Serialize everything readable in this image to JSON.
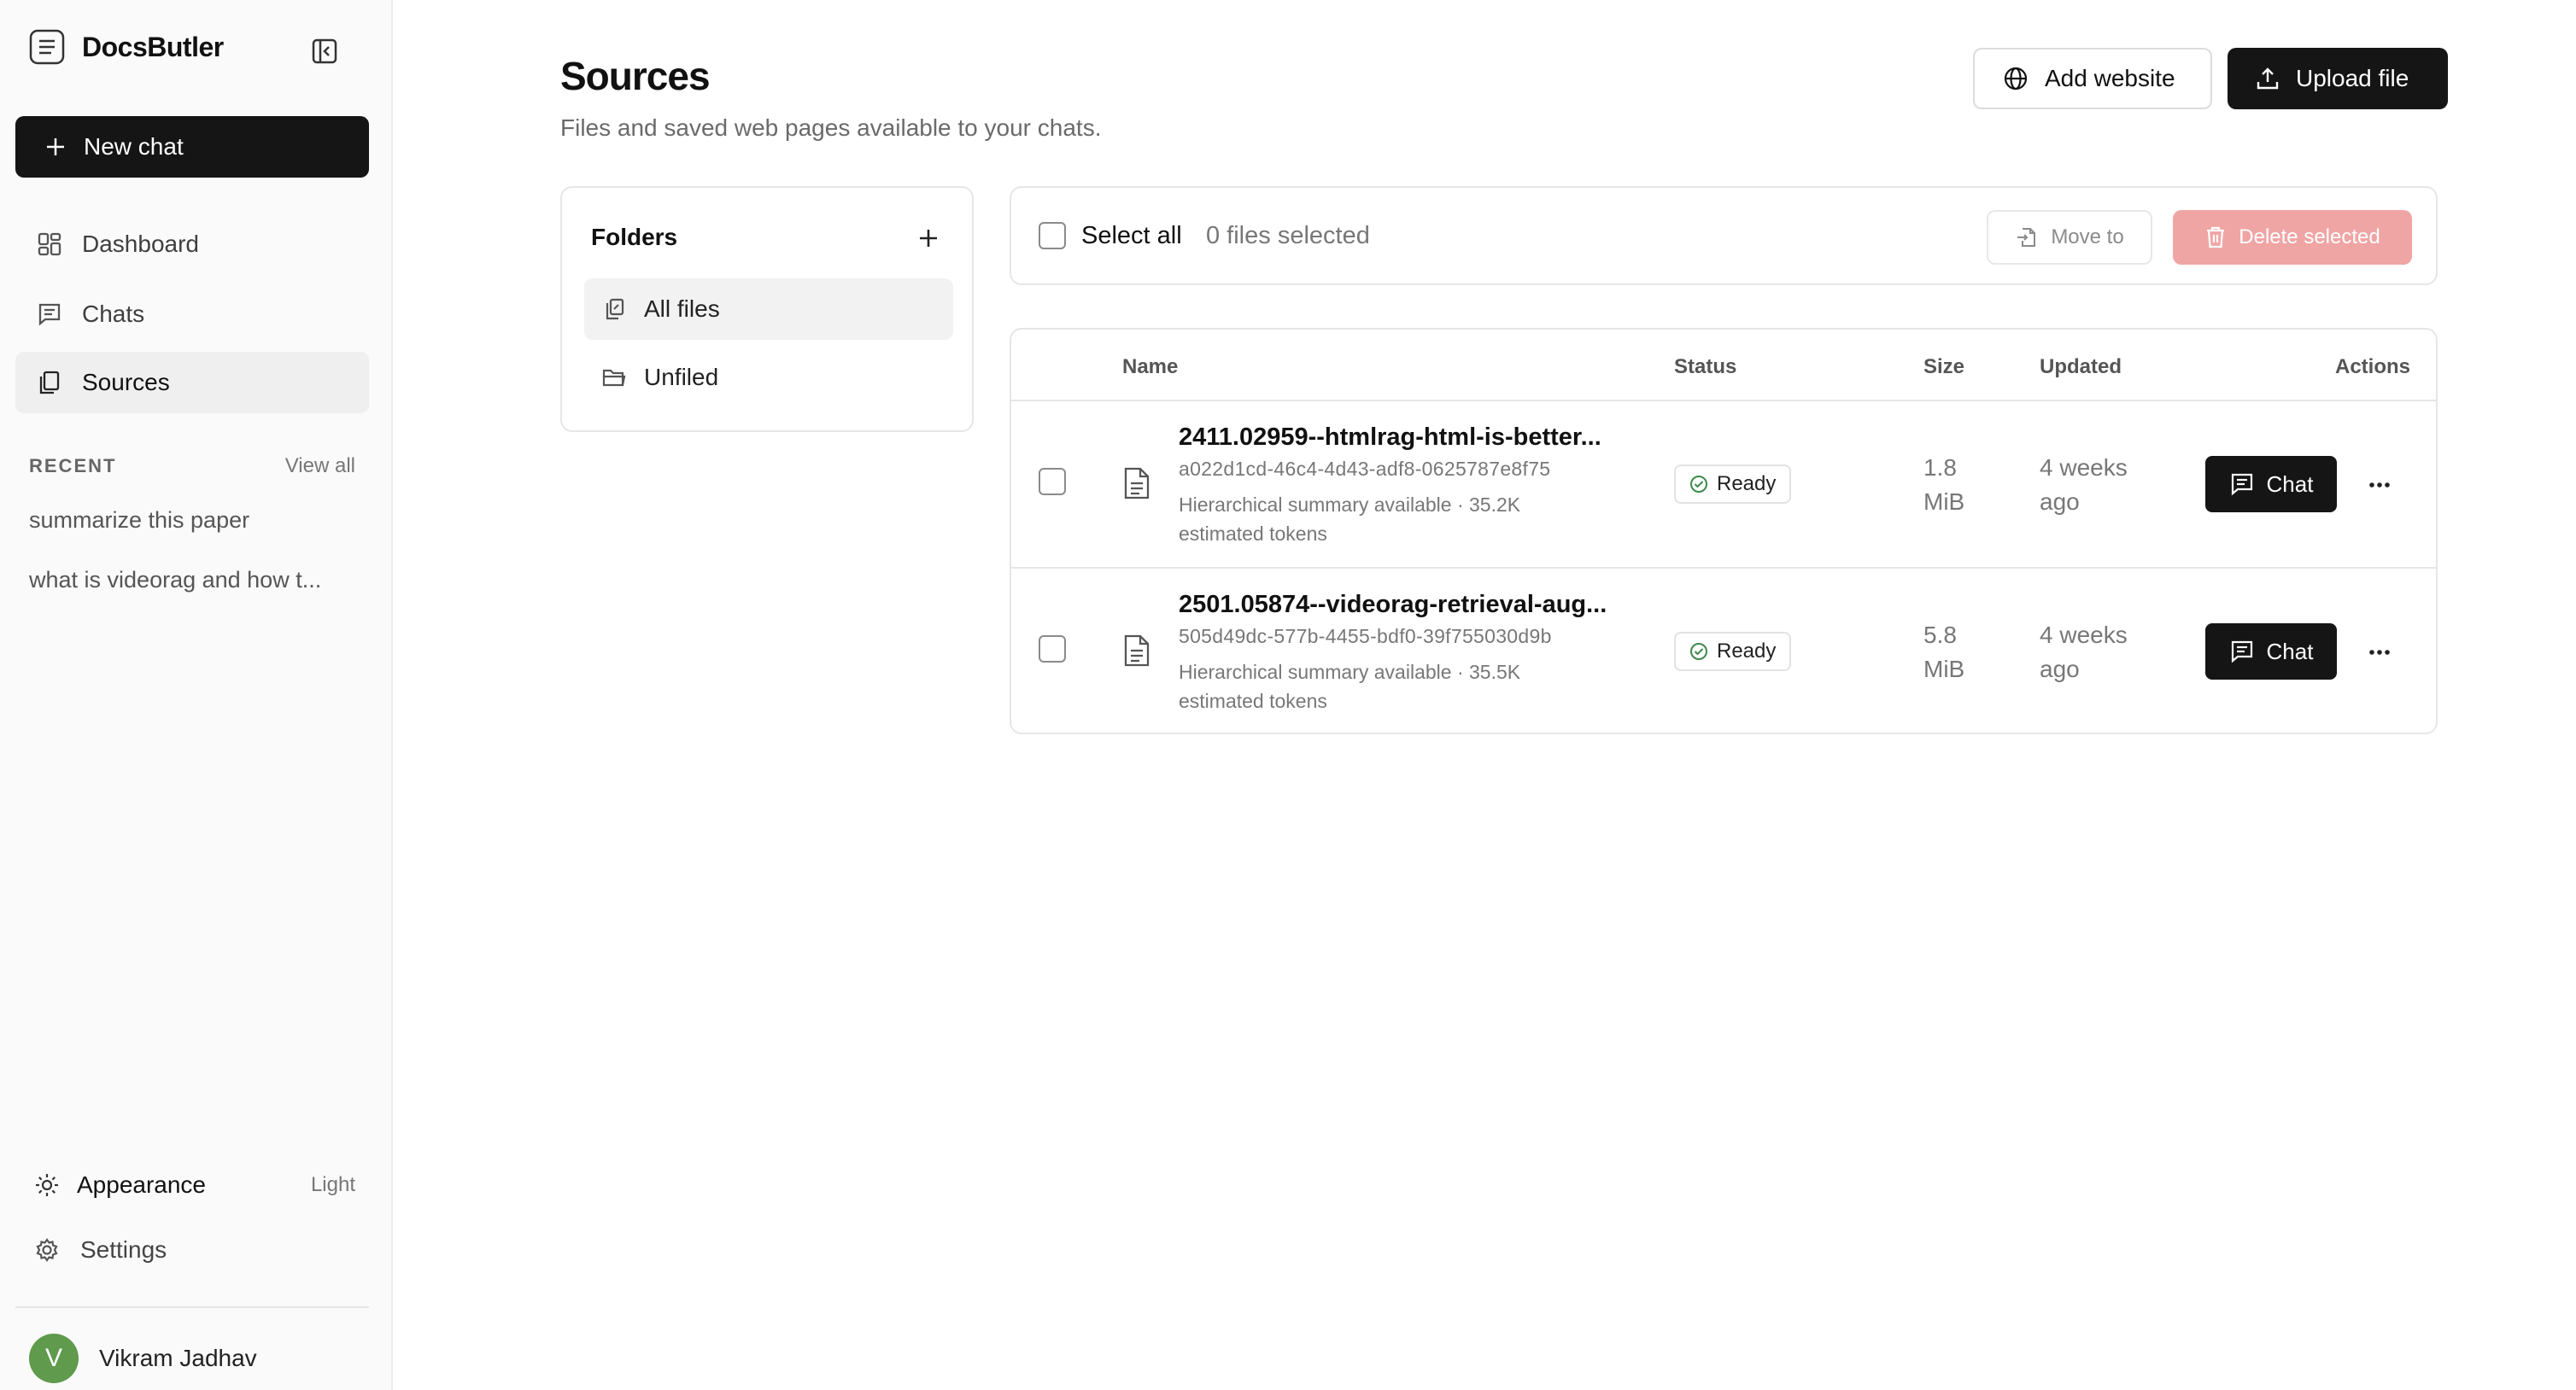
{
  "sidebar": {
    "brand": "DocsButler",
    "new_chat_label": "New chat",
    "nav": [
      {
        "label": "Dashboard",
        "icon": "dashboard-icon"
      },
      {
        "label": "Chats",
        "icon": "chat-icon"
      },
      {
        "label": "Sources",
        "icon": "sources-icon",
        "active": true
      }
    ],
    "recent_label": "RECENT",
    "view_all_label": "View all",
    "recent_items": [
      "summarize this paper",
      "what is videorag and how t..."
    ],
    "appearance_label": "Appearance",
    "appearance_value": "Light",
    "settings_label": "Settings",
    "user": {
      "initial": "V",
      "name": "Vikram Jadhav",
      "avatar_color": "#5f9a4d"
    }
  },
  "header": {
    "title": "Sources",
    "subtitle": "Files and saved web pages available to your chats.",
    "add_website_label": "Add website",
    "upload_file_label": "Upload file"
  },
  "folders": {
    "title": "Folders",
    "items": [
      {
        "label": "All files",
        "active": true
      },
      {
        "label": "Unfiled",
        "active": false
      }
    ]
  },
  "toolbar": {
    "select_all_label": "Select all",
    "selected_count": "0 files selected",
    "move_to_label": "Move to",
    "delete_selected_label": "Delete selected"
  },
  "table": {
    "columns": [
      "Name",
      "Status",
      "Size",
      "Updated",
      "Actions"
    ],
    "rows": [
      {
        "name": "2411.02959--htmlrag-html-is-better...",
        "id": "a022d1cd-46c4-4d43-adf8-0625787e8f75",
        "meta": "Hierarchical summary available · 35.2K estimated tokens",
        "status": "Ready",
        "size": "1.8 MiB",
        "updated": "4 weeks ago",
        "action_label": "Chat"
      },
      {
        "name": "2501.05874--videorag-retrieval-aug...",
        "id": "505d49dc-577b-4455-bdf0-39f755030d9b",
        "meta": "Hierarchical summary available · 35.5K estimated tokens",
        "status": "Ready",
        "size": "5.8 MiB",
        "updated": "4 weeks ago",
        "action_label": "Chat"
      }
    ]
  },
  "colors": {
    "primary_dark": "#151515",
    "danger_disabled": "#f0a5a5",
    "ready_green": "#3c8a4a"
  }
}
